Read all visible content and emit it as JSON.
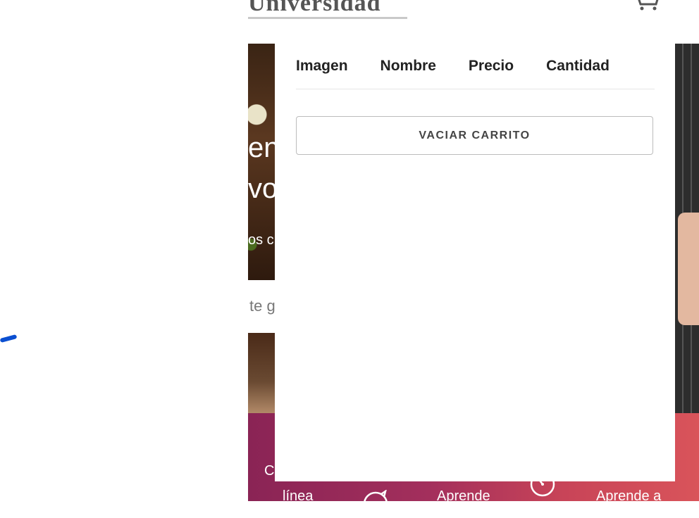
{
  "header": {
    "logo_text": "Universidad",
    "cart_icon": "shopping-cart-icon"
  },
  "background": {
    "hero_line1": "en",
    "hero_line2": "vo",
    "hero_line3": "os c",
    "subtext": "te g"
  },
  "promo": {
    "item1": "C",
    "item2": "línea",
    "item3": "Aprende",
    "item4": "Aprende a",
    "icon1": "rocket-icon",
    "icon2": "clock-icon"
  },
  "cart": {
    "columns": [
      "Imagen",
      "Nombre",
      "Precio",
      "Cantidad"
    ],
    "empty_button_label": "VACIAR CARRITO"
  },
  "colors": {
    "promo_gradient_start": "#8a2455",
    "promo_gradient_end": "#d9545a",
    "mark_blue": "#0b4fd1"
  }
}
